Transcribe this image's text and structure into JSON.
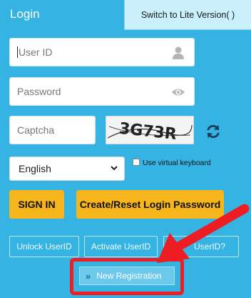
{
  "header": {
    "title": "Login",
    "lite_switch": "Switch to Lite Version( )"
  },
  "form": {
    "userid_placeholder": "User ID",
    "password_placeholder": "Password",
    "captcha_placeholder": "Captcha",
    "captcha_image_text": "3G73R",
    "language_selected": "English",
    "virtual_keyboard_label": "Use virtual keyboard",
    "virtual_keyboard_checked": false
  },
  "buttons": {
    "sign_in": "SIGN IN",
    "create_reset": "Create/Reset Login Password",
    "unlock": "Unlock UserID",
    "activate": "Activate UserID",
    "forgot": "UserID?",
    "new_registration": "New Registration"
  },
  "icons": {
    "user": "user-icon",
    "eye": "eye-icon",
    "refresh": "refresh-icon",
    "chevron": "chevron-down-icon",
    "double_chevron": "double-chevron-right-icon",
    "annotation_arrow": "red-arrow-icon"
  },
  "colors": {
    "background": "#35b4e4",
    "button_yellow": "#f7b51c",
    "annotation_red": "#ee1d24"
  }
}
